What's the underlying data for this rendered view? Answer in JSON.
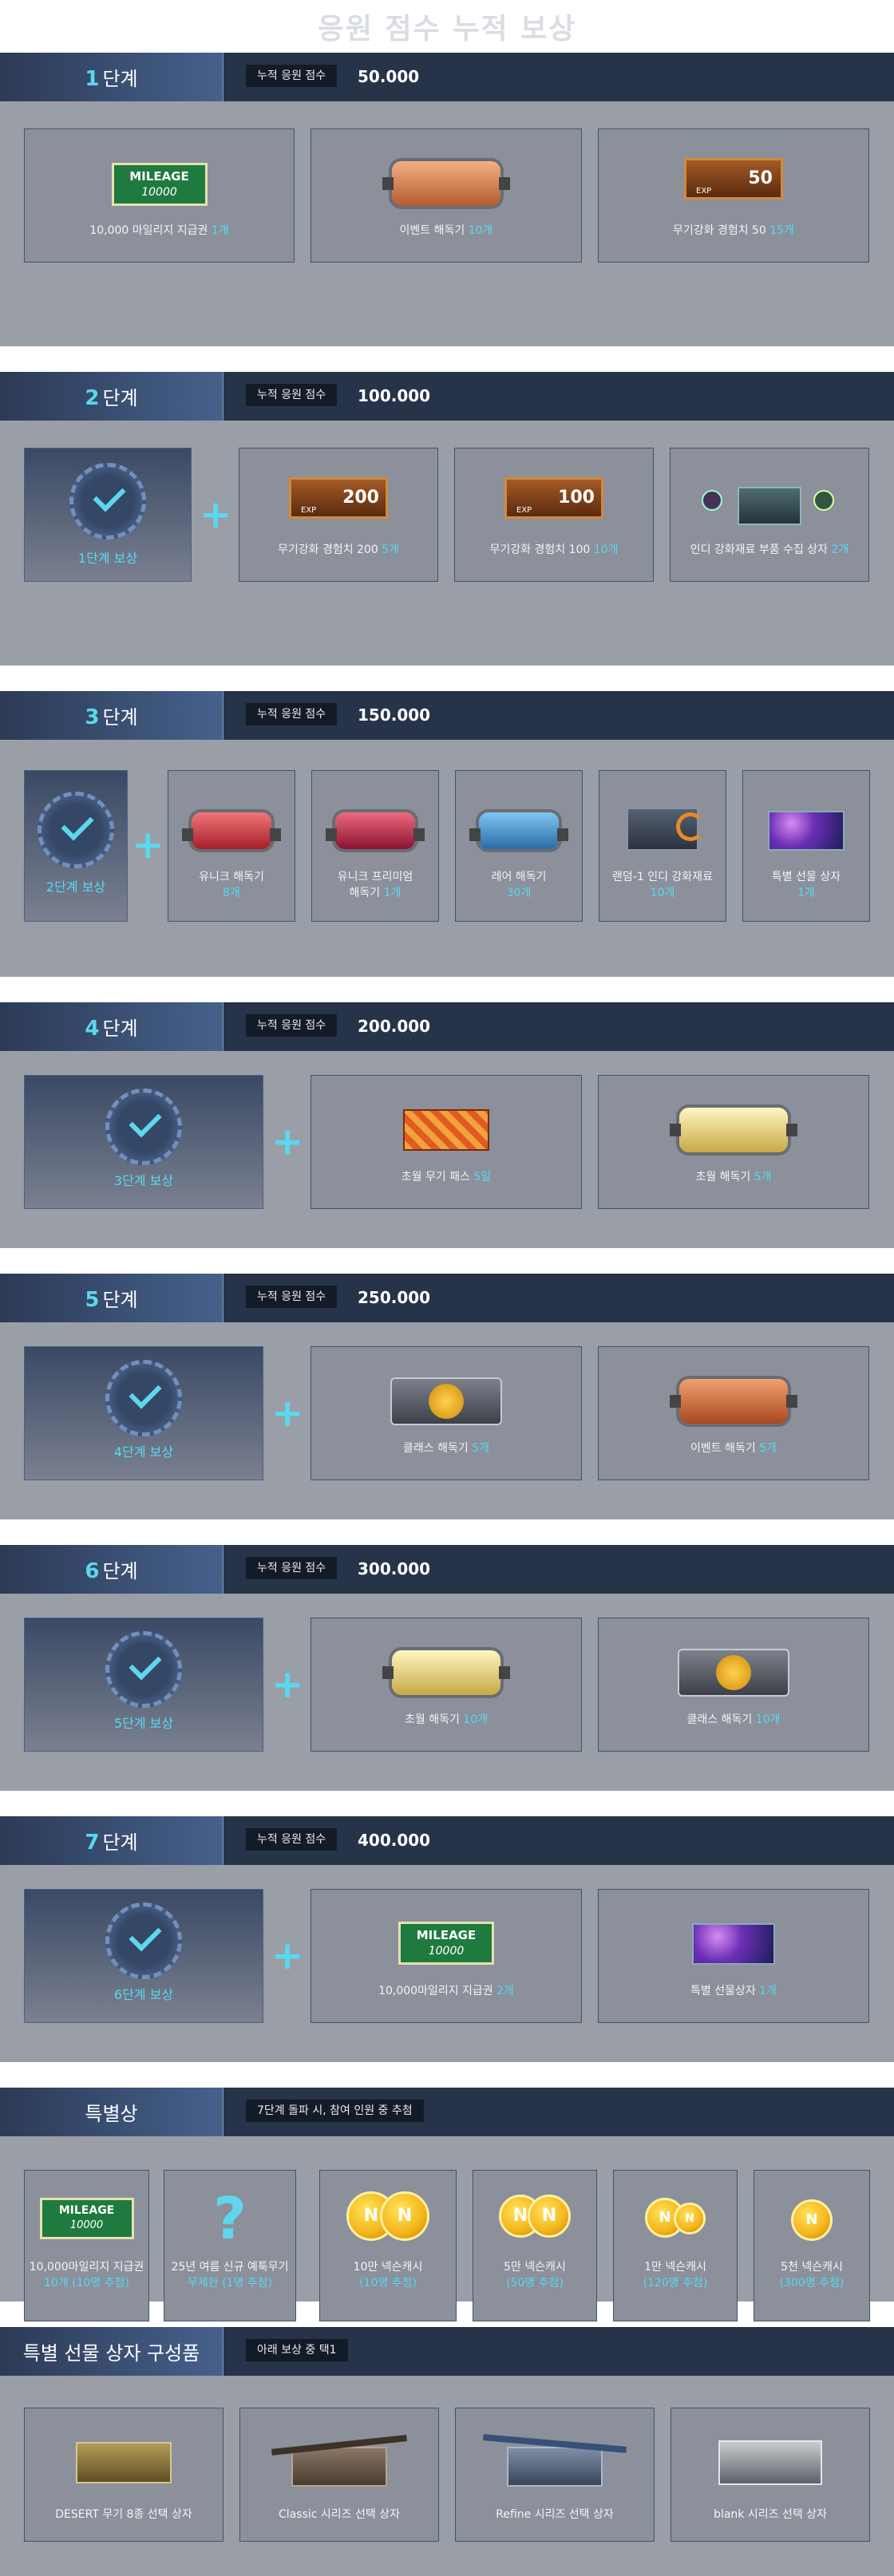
{
  "page_title": "응원 점수 누적 보상",
  "score_label": "누적 응원 점수",
  "stages": [
    {
      "num": "1",
      "unit": "단계",
      "score": "50.000"
    },
    {
      "num": "2",
      "unit": "단계",
      "score": "100.000"
    },
    {
      "num": "3",
      "unit": "단계",
      "score": "150.000"
    },
    {
      "num": "4",
      "unit": "단계",
      "score": "200.000"
    },
    {
      "num": "5",
      "unit": "단계",
      "score": "250.000"
    },
    {
      "num": "6",
      "unit": "단계",
      "score": "300.000"
    },
    {
      "num": "7",
      "unit": "단계",
      "score": "400.000"
    }
  ],
  "stage1": {
    "items": [
      {
        "name": "10,000 마일리지 지급권 ",
        "qty": "1개"
      },
      {
        "name": "이벤트 해독기 ",
        "qty": "10개"
      },
      {
        "name": "무기강화 경험치 50 ",
        "qty": "15개"
      }
    ]
  },
  "stage2": {
    "summary": "1단계 보상",
    "items": [
      {
        "name": "무기강화 경험치 200 ",
        "qty": "5개"
      },
      {
        "name": "무기강화 경험치 100 ",
        "qty": "10개"
      },
      {
        "name": "인디 강화재료 부품 수집 상자 ",
        "qty": "2개"
      }
    ]
  },
  "stage3": {
    "summary": "2단계 보상",
    "items": [
      {
        "name": "유니크 해독기",
        "qty": "8개"
      },
      {
        "name": "유니크 프리미엄",
        "name2": "해독기 ",
        "qty": "1개"
      },
      {
        "name": "레어 해독기",
        "qty": "30개"
      },
      {
        "name": "랜덤-1 인디 강화재료",
        "qty": "10개"
      },
      {
        "name": "특별 선물 상자",
        "qty": "1개"
      }
    ]
  },
  "stage4": {
    "summary": "3단계 보상",
    "items": [
      {
        "name": "초월 무기 패스 ",
        "qty": "5일"
      },
      {
        "name": "초월 해독기 ",
        "qty": "5개"
      }
    ]
  },
  "stage5": {
    "summary": "4단계 보상",
    "items": [
      {
        "name": "클래스 해독기 ",
        "qty": "5개"
      },
      {
        "name": "이벤트 해독기 ",
        "qty": "5개"
      }
    ]
  },
  "stage6": {
    "summary": "5단계 보상",
    "items": [
      {
        "name": "초월 해독기 ",
        "qty": "10개"
      },
      {
        "name": "클래스 해독기 ",
        "qty": "10개"
      }
    ]
  },
  "stage7": {
    "summary": "6단계 보상",
    "items": [
      {
        "name": "10,000마일리지 지급권 ",
        "qty": "2개"
      },
      {
        "name": "특별 선물상자 ",
        "qty": "1개"
      }
    ]
  },
  "special": {
    "title": "특별상",
    "badge": "7단계 돌파 시, 참여 인원 중 추첨",
    "items": [
      {
        "name": "10,000마일리지 지급권",
        "qty": "10개 (10명 추첨)"
      },
      {
        "name": "25년 여름 신규 예툭무기",
        "qty": "무제한 (1명 추첨)"
      },
      {
        "name": "10만 넥슨캐시",
        "qty": "(10명 추첨)"
      },
      {
        "name": "5만 넥슨캐시",
        "qty": "(50명 추첨)"
      },
      {
        "name": "1만 넥슨캐시",
        "qty": "(120명 추첨)"
      },
      {
        "name": "5천 넥슨캐시",
        "qty": "(300명 추첨)"
      }
    ]
  },
  "giftbox": {
    "title": "특별 선물 상자 구성품",
    "badge": "아래 보상 중 택1",
    "items": [
      {
        "name": "DESERT 무기 8종 선택 상자"
      },
      {
        "name": "Classic 시리즈 선택 상자"
      },
      {
        "name": "Refine 시리즈 선택 상자"
      },
      {
        "name": "blank 시리즈 선택 상자"
      }
    ]
  },
  "art_text": {
    "mileage": "MILEAGE",
    "mileage_amt": "10000",
    "exp": "EXP",
    "exp50": "50",
    "exp200": "200",
    "exp100": "100",
    "question": "?",
    "coin": "N"
  },
  "colors": {
    "header_bg": "#273349",
    "accent": "#58d8ef",
    "body_bg": "#9a9ea7"
  }
}
